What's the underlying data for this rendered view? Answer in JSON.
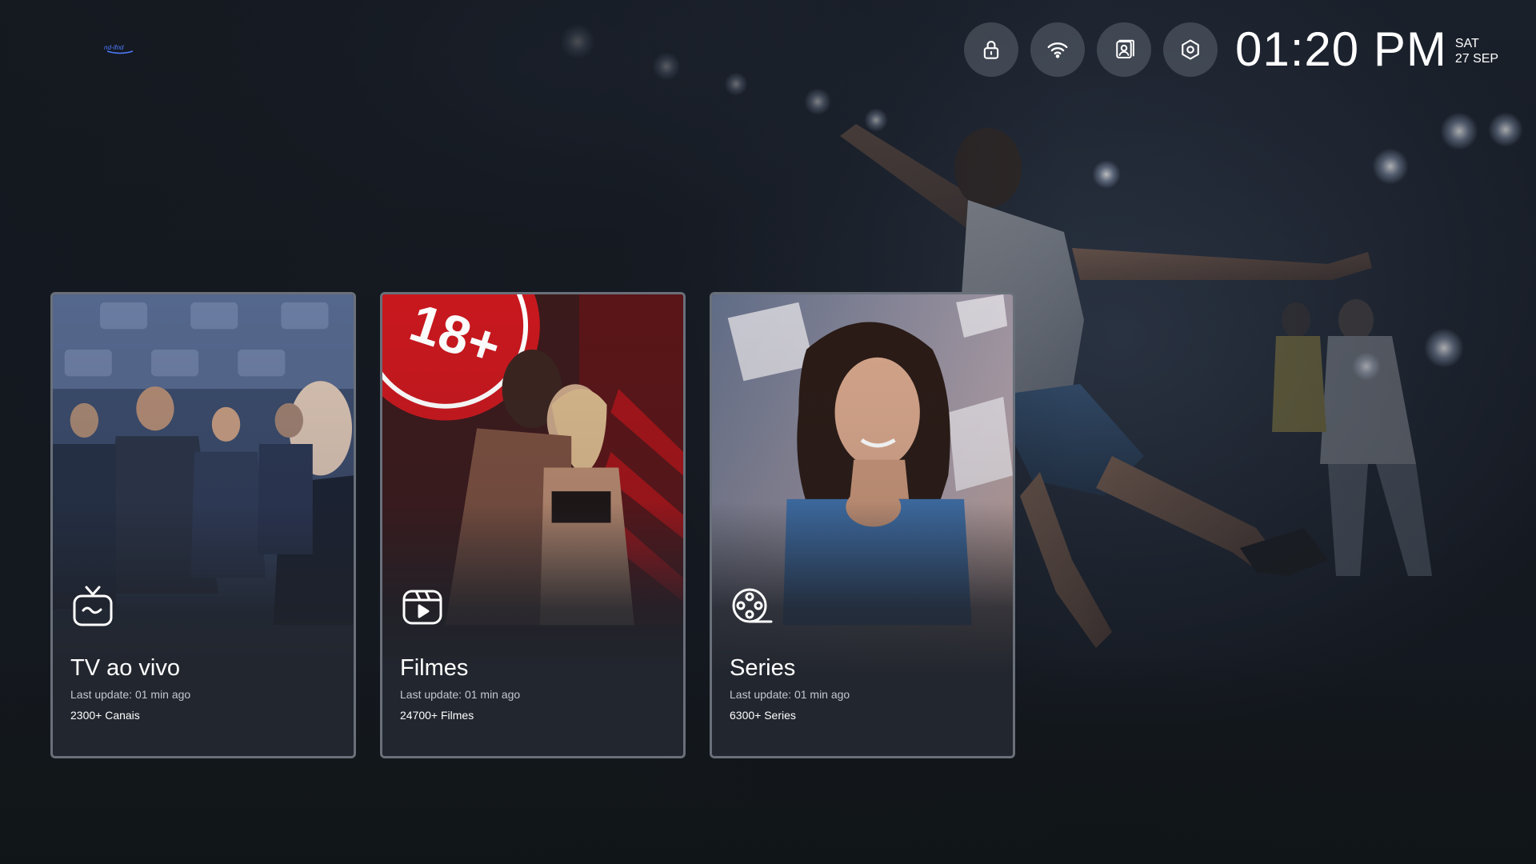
{
  "app": {
    "logo_alt": "app-logo"
  },
  "header": {
    "icons": [
      {
        "name": "lock-icon"
      },
      {
        "name": "wifi-icon"
      },
      {
        "name": "profile-icon"
      },
      {
        "name": "settings-icon"
      }
    ],
    "clock": {
      "time": "01:20 PM",
      "day": "SAT",
      "date": "27 SEP"
    }
  },
  "cards": [
    {
      "title": "TV ao vivo",
      "update": "Last update: 01 min ago",
      "count": "2300+ Canais",
      "icon": "tv-icon"
    },
    {
      "title": "Filmes",
      "update": "Last update: 01 min ago",
      "count": "24700+ Filmes",
      "icon": "movie-play-icon"
    },
    {
      "title": "Series",
      "update": "Last update: 01 min ago",
      "count": "6300+ Series",
      "icon": "film-reel-icon"
    }
  ],
  "colors": {
    "background": "#14181f",
    "card_bg": "#22262e",
    "card_border": "#aab0bc",
    "accent_red": "#c8181e",
    "text_muted": "#c3c7cf"
  }
}
